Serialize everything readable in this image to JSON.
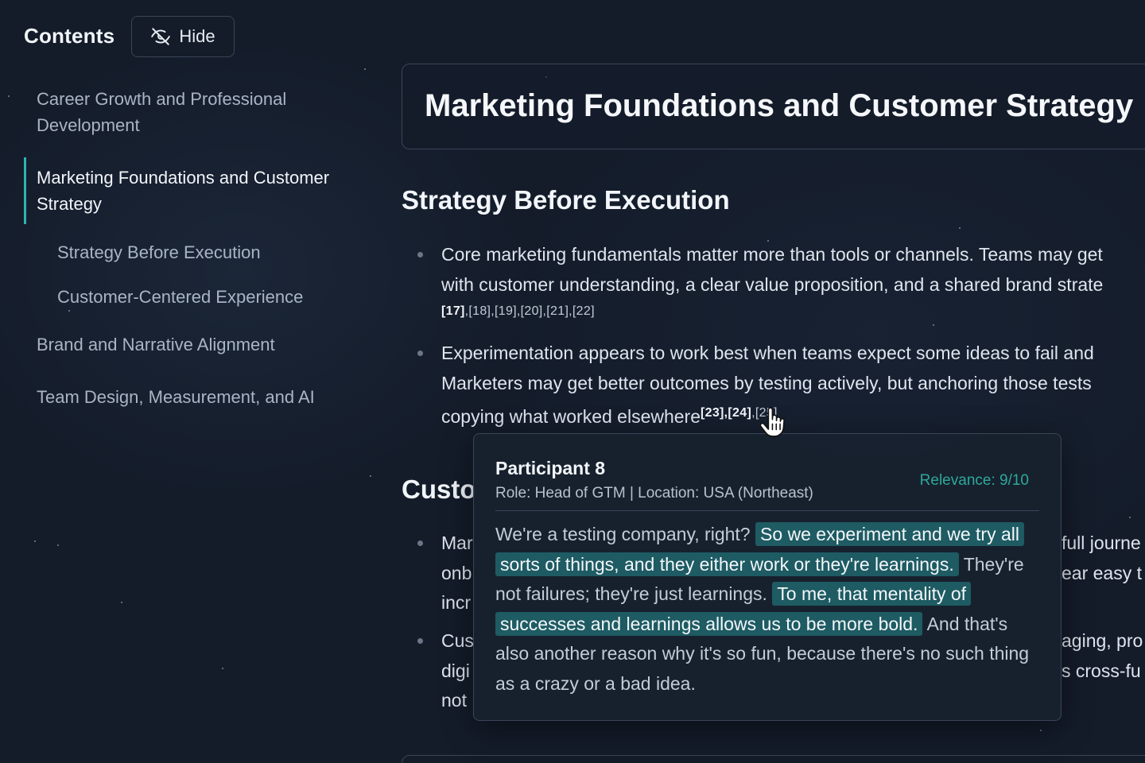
{
  "sidebar": {
    "title": "Contents",
    "hide_label": "Hide",
    "items": [
      {
        "label": "Career Growth and Professional Development"
      },
      {
        "label": "Marketing Foundations and Customer Strategy"
      },
      {
        "label": "Strategy Before Execution"
      },
      {
        "label": "Customer-Centered Experience"
      },
      {
        "label": "Brand and Narrative Alignment"
      },
      {
        "label": "Team Design, Measurement, and AI"
      }
    ]
  },
  "main": {
    "title": "Marketing Foundations and Customer Strategy",
    "section1": {
      "heading": "Strategy Before Execution",
      "bullet1": {
        "line1": "Core marketing fundamentals matter more than tools or channels. Teams may get",
        "line2": "with customer understanding, a clear value proposition, and a shared brand strate",
        "cite_strong": "[17]",
        "cites_rest": ",[18],[19],[20],[21],[22]"
      },
      "bullet2": {
        "line1": "Experimentation appears to work best when teams expect some ideas to fail and",
        "line2": "Marketers may get better outcomes by testing actively, but anchoring those tests",
        "line3": "copying what worked elsewhere",
        "cite_a": "[23],",
        "cite_b": "[24]",
        "cite_c": ",[25]",
        "period": "."
      }
    },
    "section2": {
      "heading_visible": "Custo",
      "bullet1": {
        "line1": "Mar",
        "line1_right": "full journe",
        "line2": "onb",
        "line2_right": "ear easy t",
        "line3": "incr"
      },
      "bullet2": {
        "line1": "Cus",
        "line1_right": "aging, pro",
        "line2": "digi",
        "line2_right": "s cross-fu",
        "line3": "not"
      }
    }
  },
  "popover": {
    "name": "Participant 8",
    "meta": "Role: Head of GTM | Location: USA (Northeast)",
    "relevance": "Relevance: 9/10",
    "q1": "We're a testing company, right?",
    "q2": "So we experiment and we try all sorts of things, and they either work or they're learnings.",
    "q3": "They're not failures; they're just learnings.",
    "q4": "To me, that mentality of successes and learnings allows us to be more bold.",
    "q5": "And that's also another reason why it's so fun, because there's no such thing as a crazy or a bad idea."
  },
  "colors": {
    "background": "#141c2a",
    "accent": "#2fb3b0",
    "highlight": "#1e5b63",
    "relevance": "#2fa89a"
  },
  "icons": {
    "hide": "eye-off-icon",
    "cursor": "hand-pointer-icon"
  }
}
